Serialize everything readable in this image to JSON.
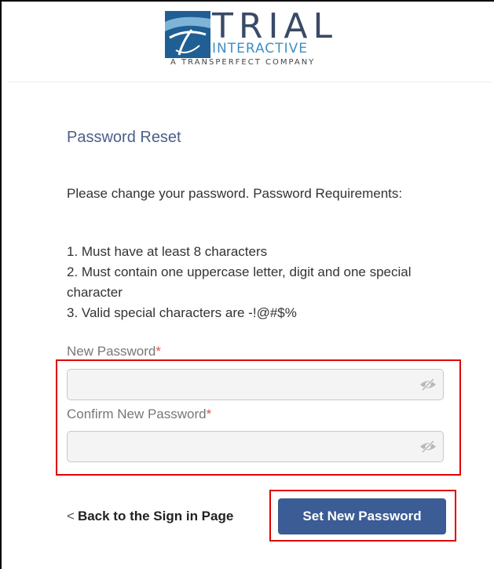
{
  "logo": {
    "name": "TRIAL",
    "subtitle": "INTERACTIVE",
    "tagline": "A TRANSPERFECT COMPANY"
  },
  "form": {
    "title": "Password Reset",
    "intro": "Please change your password. Password Requirements:",
    "requirements": [
      "1. Must have at least 8 characters",
      "2. Must contain one uppercase letter, digit and one special character",
      "3. Valid special characters are -!@#$%"
    ],
    "new_password_label": "New Password",
    "confirm_password_label": "Confirm New Password",
    "required_marker": "*",
    "new_password_value": "",
    "confirm_password_value": "",
    "back_prefix": "<",
    "back_label": "Back to the Sign in Page",
    "submit_label": "Set New Password"
  },
  "colors": {
    "title": "#4a5f8a",
    "button": "#3b5c94",
    "required": "#e05050",
    "highlight": "#e00000"
  }
}
